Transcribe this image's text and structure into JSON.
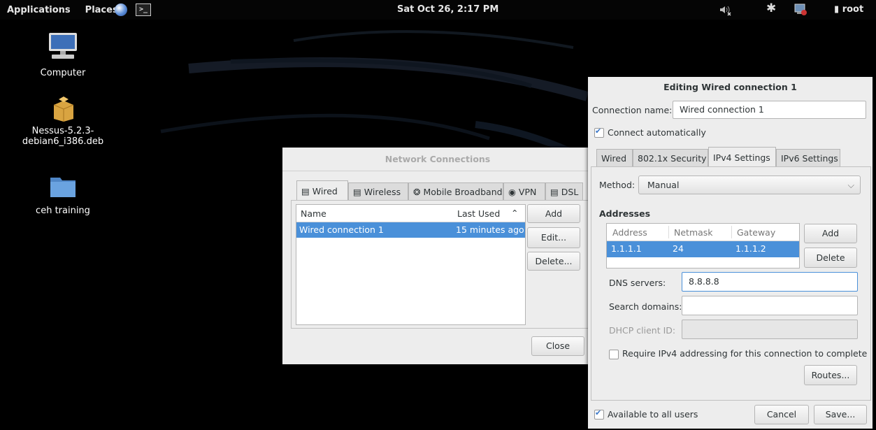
{
  "topbar": {
    "applications": "Applications",
    "places": "Places",
    "terminal_glyph": ">_",
    "clock": "Sat Oct 26,  2:17 PM",
    "user": "root"
  },
  "desktop": {
    "icons": [
      {
        "label": "Computer"
      },
      {
        "label_line1": "Nessus-5.2.3-",
        "label_line2": "debian6_i386.deb"
      },
      {
        "label": "ceh training"
      }
    ]
  },
  "network_connections": {
    "title": "Network Connections",
    "tabs": [
      "Wired",
      "Wireless",
      "Mobile Broadband",
      "VPN",
      "DSL"
    ],
    "columns": [
      "Name",
      "Last Used"
    ],
    "rows": [
      {
        "name": "Wired connection 1",
        "last_used": "15 minutes ago"
      }
    ],
    "buttons": {
      "add": "Add",
      "edit": "Edit...",
      "delete": "Delete...",
      "close": "Close"
    }
  },
  "edit_dialog": {
    "title": "Editing Wired connection 1",
    "connection_name_label": "Connection name:",
    "connection_name_value": "Wired connection 1",
    "connect_automatically": "Connect automatically",
    "tabs": [
      "Wired",
      "802.1x Security",
      "IPv4 Settings",
      "IPv6 Settings"
    ],
    "method_label": "Method:",
    "method_value": "Manual",
    "addresses_heading": "Addresses",
    "address_columns": [
      "Address",
      "Netmask",
      "Gateway"
    ],
    "address_rows": [
      {
        "address": "1.1.1.1",
        "netmask": "24",
        "gateway": "1.1.1.2"
      }
    ],
    "add_button": "Add",
    "delete_button": "Delete",
    "dns_label": "DNS servers:",
    "dns_value": "8.8.8.8",
    "search_domains_label": "Search domains:",
    "search_domains_value": "",
    "dhcp_label": "DHCP client ID:",
    "dhcp_value": "",
    "require_ipv4": "Require IPv4 addressing for this connection to complete",
    "routes_button": "Routes...",
    "available_all_users": "Available to all users",
    "cancel_button": "Cancel",
    "save_button": "Save..."
  },
  "colors": {
    "selection": "#4a90d9",
    "dialog_bg": "#ededed",
    "accent_check": "#3a77c8"
  }
}
